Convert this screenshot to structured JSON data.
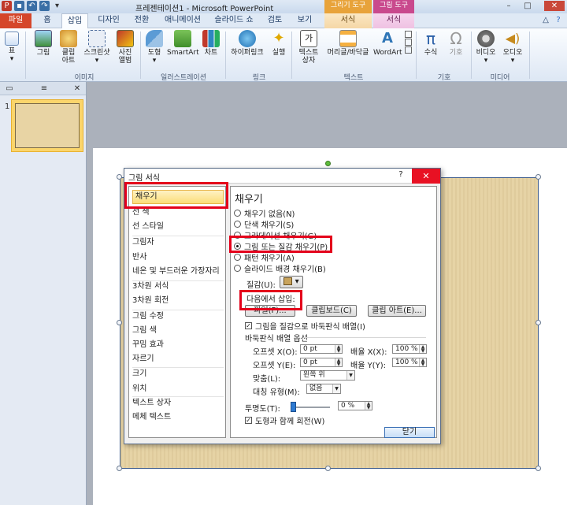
{
  "app_title": "프레젠테이션1 - Microsoft PowerPoint",
  "context_tab_titles": {
    "drawing_tools": "그리기 도구",
    "picture_tools": "그림 도구"
  },
  "tabs": [
    "파일",
    "홈",
    "삽입",
    "디자인",
    "전환",
    "애니메이션",
    "슬라이드 쇼",
    "검토",
    "보기",
    "서식",
    "서식"
  ],
  "ribbon": {
    "buttons": [
      {
        "label": "표",
        "sub": ""
      },
      {
        "label": "그림",
        "sub": ""
      },
      {
        "label": "클립",
        "sub": "아트"
      },
      {
        "label": "스크린샷",
        "sub": ""
      },
      {
        "label": "사진",
        "sub": "앨범"
      },
      {
        "label": "도형",
        "sub": ""
      },
      {
        "label": "SmartArt",
        "sub": ""
      },
      {
        "label": "차트",
        "sub": ""
      },
      {
        "label": "하이퍼링크",
        "sub": ""
      },
      {
        "label": "실행",
        "sub": ""
      },
      {
        "label": "텍스트",
        "sub": "상자"
      },
      {
        "label": "머리글/바닥글",
        "sub": ""
      },
      {
        "label": "WordArt",
        "sub": ""
      },
      {
        "label": "수식",
        "sub": ""
      },
      {
        "label": "기호",
        "sub": ""
      },
      {
        "label": "비디오",
        "sub": ""
      },
      {
        "label": "오디오",
        "sub": ""
      }
    ],
    "groups": [
      "표",
      "이미지",
      "일러스트레이션",
      "링크",
      "텍스트",
      "기호",
      "미디어"
    ]
  },
  "slide_pane": {
    "slide_number": "1"
  },
  "dialog": {
    "title": "그림 서식",
    "help": "?",
    "close": "✕",
    "categories": [
      "채우기",
      "선 색",
      "선 스타일",
      "그림자",
      "반사",
      "네온 및 부드러운 가장자리",
      "3차원 서식",
      "3차원 회전",
      "그림 수정",
      "그림 색",
      "꾸밈 효과",
      "자르기",
      "크기",
      "위치",
      "텍스트 상자",
      "메체 텍스트"
    ],
    "fill": {
      "section_title": "채우기",
      "options": [
        "채우기 없음(N)",
        "단색 채우기(S)",
        "그라데이션 채우기(G)",
        "그림 또는 질감 채우기(P)",
        "패턴 채우기(A)",
        "슬라이드 배경 채우기(B)"
      ],
      "selected_option": 3,
      "texture_label": "질감(U):",
      "insert_from_label": "다음에서 삽입:",
      "file_button": "파일(F)...",
      "clipboard_button": "클립보드(C)",
      "clipart_button": "클립 아트(E)...",
      "tile_checkbox": "그림을 질감으로 바둑판식 배열(I)",
      "tile_checked": true,
      "tiling_options_label": "바둑판식 배열 옵션",
      "offset_x_label": "오프셋 X(O):",
      "offset_x_value": "0 pt",
      "scale_x_label": "배율 X(X):",
      "scale_x_value": "100 %",
      "offset_y_label": "오프셋 Y(E):",
      "offset_y_value": "0 pt",
      "scale_y_label": "배율 Y(Y):",
      "scale_y_value": "100 %",
      "align_label": "맞춤(L):",
      "align_value": "왼쪽 위",
      "mirror_label": "대칭 유형(M):",
      "mirror_value": "없음",
      "transparency_label": "투명도(T):",
      "transparency_value": "0 %",
      "rotate_checkbox": "도형과 함께 회전(W)",
      "rotate_checked": true
    },
    "close_button": "닫기"
  },
  "colors": {
    "file_tab": "#d5462a",
    "highlight": "#e4001b",
    "close_red": "#e81123",
    "selected_cat": "#fbdd78"
  }
}
